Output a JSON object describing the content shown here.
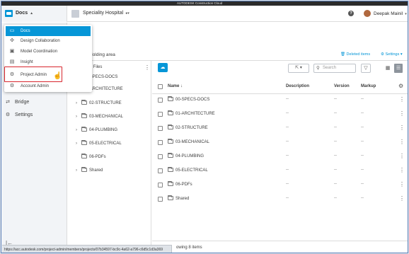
{
  "topbar": {
    "brand": "AUTODESK Construction Cloud"
  },
  "header": {
    "app_name": "Docs",
    "project_name": "Speciality Hospital",
    "help": "?",
    "user_name": "Deepak Mainil"
  },
  "app_menu": {
    "items": [
      {
        "label": "Docs",
        "icon": "docs-icon",
        "active": true
      },
      {
        "label": "Design Collaboration",
        "icon": "design-collaboration-icon"
      },
      {
        "label": "Model Coordination",
        "icon": "model-coordination-icon"
      },
      {
        "label": "Insight",
        "icon": "insight-icon"
      },
      {
        "label": "Project Admin",
        "icon": "gear-icon",
        "highlighted": true
      },
      {
        "label": "Account Admin",
        "icon": "gear-icon"
      }
    ]
  },
  "sidebar": {
    "items": [
      {
        "label": "Bridge",
        "icon": "bridge-icon"
      },
      {
        "label": "Settings",
        "icon": "gear-icon"
      }
    ]
  },
  "main": {
    "tab": "Holding area",
    "deleted_items": "Deleted items",
    "settings": "Settings"
  },
  "tree": {
    "header": "ect Files",
    "items": [
      {
        "label": "00-SPECS-DOCS",
        "chevron": false
      },
      {
        "label": "01-ARCHITECTURE",
        "chevron": false
      },
      {
        "label": "02-STRUCTURE",
        "chevron": true
      },
      {
        "label": "03-MECHANICAL",
        "chevron": true
      },
      {
        "label": "04-PLUMBING",
        "chevron": true
      },
      {
        "label": "05-ELECTRICAL",
        "chevron": true
      },
      {
        "label": "06-PDFs",
        "chevron": false
      },
      {
        "label": "Shared",
        "chevron": true
      }
    ]
  },
  "toolbar": {
    "search_placeholder": "Search"
  },
  "columns": {
    "name": "Name",
    "description": "Description",
    "version": "Version",
    "markup": "Markup"
  },
  "rows": [
    {
      "name": "00-SPECS-DOCS",
      "description": "--",
      "version": "--",
      "markup": "--"
    },
    {
      "name": "01-ARCHITECTURE",
      "description": "--",
      "version": "--",
      "markup": "--"
    },
    {
      "name": "02-STRUCTURE",
      "description": "--",
      "version": "--",
      "markup": "--"
    },
    {
      "name": "03-MECHANICAL",
      "description": "--",
      "version": "--",
      "markup": "--"
    },
    {
      "name": "04-PLUMBING",
      "description": "--",
      "version": "--",
      "markup": "--"
    },
    {
      "name": "05-ELECTRICAL",
      "description": "--",
      "version": "--",
      "markup": "--"
    },
    {
      "name": "06-PDFs",
      "description": "--",
      "version": "--",
      "markup": "--"
    },
    {
      "name": "Shared",
      "description": "--",
      "version": "--",
      "markup": "--"
    }
  ],
  "footer": {
    "showing": "owing 8 items"
  },
  "statusbar": {
    "url": "https://acc.autodesk.com/project-admin/members/projects/07b34597-bc9c-4a62-a796-c6d5c1d3a369"
  },
  "colors": {
    "accent": "#0696d7",
    "highlight": "#d7262d"
  }
}
